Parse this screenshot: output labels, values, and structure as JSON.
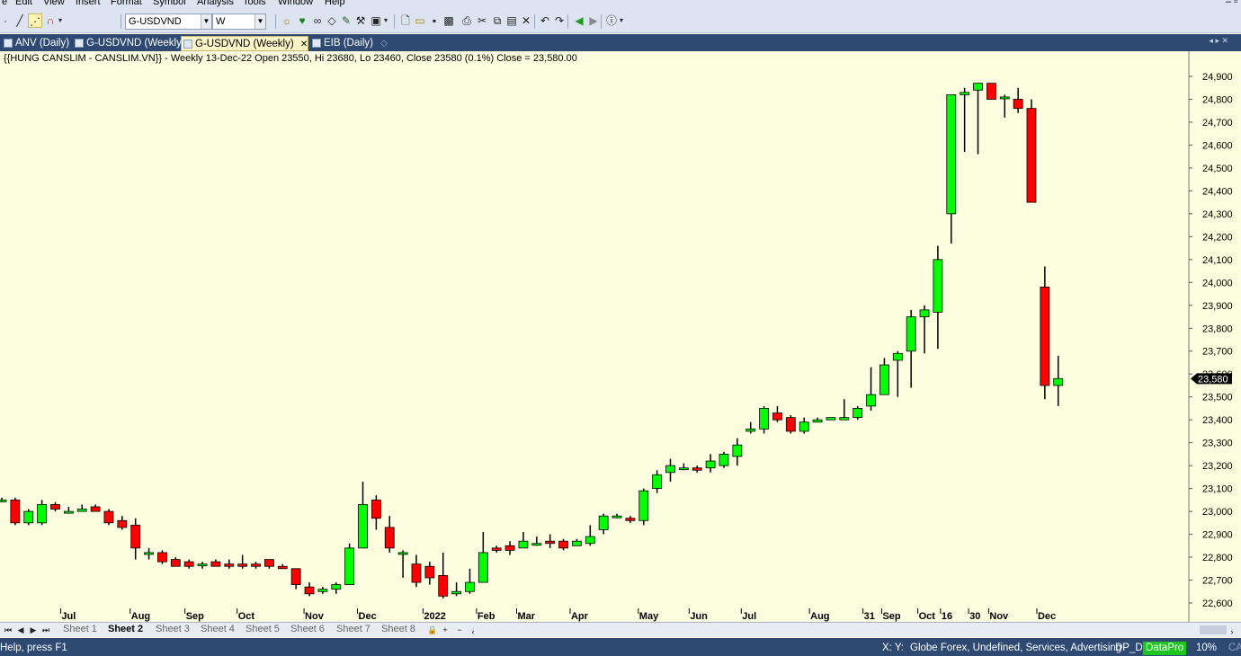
{
  "menu": [
    "e",
    "Edit",
    "View",
    "Insert",
    "Format",
    "Symbol",
    "Analysis",
    "Tools",
    "Window",
    "Help"
  ],
  "toolbar": {
    "symbol_value": "G-USDVND",
    "interval_value": "W"
  },
  "tabs": [
    {
      "label": "ANV (Daily)",
      "active": false
    },
    {
      "label": "G-USDVND (Weekly)",
      "active": false
    },
    {
      "label": "G-USDVND (Weekly)",
      "active": true
    },
    {
      "label": "EIB (Daily)",
      "active": false
    }
  ],
  "chart_title_line": "{{HUNG CANSLIM - CANSLIM.VN}} - Weekly 13-Dec-22 Open 23550, Hi 23680, Lo 23460, Close 23580 (0.1%) Close = 23,580.00",
  "sheets": {
    "nav": [
      "⏮",
      "◀",
      "▶",
      "⏭"
    ],
    "tabs": [
      "Sheet 1",
      "Sheet 2",
      "Sheet 3",
      "Sheet 4",
      "Sheet 5",
      "Sheet 6",
      "Sheet 7",
      "Sheet 8"
    ],
    "active": "Sheet 2"
  },
  "status": {
    "help": "Help, press F1",
    "xy": "X:  Y:",
    "info": "Globe Forex, Undefined, Services, Advertising",
    "db": "DP_D",
    "datapro": "DataPro",
    "pct": "10%",
    "cap": "CA"
  },
  "colors": {
    "up": "#00ff00",
    "down": "#ff0000",
    "background": "#fdfde0",
    "tabbar": "#2e4a73"
  },
  "chart_data": {
    "type": "candlestick",
    "symbol": "G-USDVND",
    "last_value_label": "23,580",
    "ylim": [
      22550,
      24980
    ],
    "y_ticks": [
      22600,
      22700,
      22800,
      22900,
      23000,
      23100,
      23200,
      23300,
      23400,
      23500,
      23600,
      23700,
      23800,
      23900,
      24000,
      24100,
      24200,
      24300,
      24400,
      24500,
      24600,
      24700,
      24800,
      24900
    ],
    "x_labels": [
      "Jul",
      "Aug",
      "Sep",
      "Oct",
      "Nov",
      "Dec",
      "2022",
      "Feb",
      "Mar",
      "Apr",
      "May",
      "Jun",
      "Jul",
      "Aug",
      "31",
      "Sep",
      "Oct",
      "16",
      "30",
      "Nov",
      "Dec"
    ],
    "candles": [
      {
        "o": 23050,
        "h": 23060,
        "l": 23040,
        "c": 23050
      },
      {
        "o": 23050,
        "h": 23060,
        "l": 22940,
        "c": 22950
      },
      {
        "o": 22950,
        "h": 23010,
        "l": 22940,
        "c": 23000
      },
      {
        "o": 22950,
        "h": 23050,
        "l": 22940,
        "c": 23030
      },
      {
        "o": 23030,
        "h": 23040,
        "l": 23000,
        "c": 23010
      },
      {
        "o": 23000,
        "h": 23020,
        "l": 22990,
        "c": 23000
      },
      {
        "o": 23000,
        "h": 23030,
        "l": 23000,
        "c": 23010
      },
      {
        "o": 23020,
        "h": 23030,
        "l": 23000,
        "c": 23000
      },
      {
        "o": 23000,
        "h": 23010,
        "l": 22940,
        "c": 22950
      },
      {
        "o": 22960,
        "h": 22980,
        "l": 22920,
        "c": 22930
      },
      {
        "o": 22940,
        "h": 22970,
        "l": 22790,
        "c": 22840
      },
      {
        "o": 22820,
        "h": 22840,
        "l": 22790,
        "c": 22820
      },
      {
        "o": 22820,
        "h": 22830,
        "l": 22770,
        "c": 22780
      },
      {
        "o": 22790,
        "h": 22800,
        "l": 22760,
        "c": 22760
      },
      {
        "o": 22780,
        "h": 22790,
        "l": 22750,
        "c": 22760
      },
      {
        "o": 22770,
        "h": 22780,
        "l": 22750,
        "c": 22770
      },
      {
        "o": 22780,
        "h": 22790,
        "l": 22760,
        "c": 22760
      },
      {
        "o": 22770,
        "h": 22790,
        "l": 22750,
        "c": 22760
      },
      {
        "o": 22770,
        "h": 22810,
        "l": 22750,
        "c": 22760
      },
      {
        "o": 22770,
        "h": 22780,
        "l": 22750,
        "c": 22760
      },
      {
        "o": 22790,
        "h": 22790,
        "l": 22750,
        "c": 22760
      },
      {
        "o": 22760,
        "h": 22770,
        "l": 22750,
        "c": 22750
      },
      {
        "o": 22750,
        "h": 22750,
        "l": 22660,
        "c": 22680
      },
      {
        "o": 22670,
        "h": 22690,
        "l": 22630,
        "c": 22640
      },
      {
        "o": 22650,
        "h": 22670,
        "l": 22640,
        "c": 22660
      },
      {
        "o": 22660,
        "h": 22690,
        "l": 22640,
        "c": 22680
      },
      {
        "o": 22680,
        "h": 22860,
        "l": 22680,
        "c": 22840
      },
      {
        "o": 22840,
        "h": 23130,
        "l": 22840,
        "c": 23030
      },
      {
        "o": 23050,
        "h": 23070,
        "l": 22920,
        "c": 22970
      },
      {
        "o": 22930,
        "h": 22980,
        "l": 22820,
        "c": 22840
      },
      {
        "o": 22820,
        "h": 22830,
        "l": 22710,
        "c": 22820
      },
      {
        "o": 22770,
        "h": 22810,
        "l": 22670,
        "c": 22690
      },
      {
        "o": 22760,
        "h": 22780,
        "l": 22680,
        "c": 22710
      },
      {
        "o": 22720,
        "h": 22820,
        "l": 22620,
        "c": 22630
      },
      {
        "o": 22640,
        "h": 22690,
        "l": 22630,
        "c": 22650
      },
      {
        "o": 22650,
        "h": 22750,
        "l": 22640,
        "c": 22690
      },
      {
        "o": 22690,
        "h": 22910,
        "l": 22690,
        "c": 22820
      },
      {
        "o": 22840,
        "h": 22850,
        "l": 22820,
        "c": 22830
      },
      {
        "o": 22850,
        "h": 22870,
        "l": 22810,
        "c": 22830
      },
      {
        "o": 22840,
        "h": 22910,
        "l": 22840,
        "c": 22870
      },
      {
        "o": 22860,
        "h": 22890,
        "l": 22850,
        "c": 22860
      },
      {
        "o": 22870,
        "h": 22900,
        "l": 22840,
        "c": 22860
      },
      {
        "o": 22870,
        "h": 22880,
        "l": 22830,
        "c": 22840
      },
      {
        "o": 22850,
        "h": 22880,
        "l": 22850,
        "c": 22870
      },
      {
        "o": 22860,
        "h": 22940,
        "l": 22850,
        "c": 22890
      },
      {
        "o": 22920,
        "h": 22990,
        "l": 22900,
        "c": 22980
      },
      {
        "o": 22980,
        "h": 22990,
        "l": 22970,
        "c": 22980
      },
      {
        "o": 22970,
        "h": 22980,
        "l": 22950,
        "c": 22960
      },
      {
        "o": 22960,
        "h": 23100,
        "l": 22940,
        "c": 23090
      },
      {
        "o": 23100,
        "h": 23180,
        "l": 23080,
        "c": 23160
      },
      {
        "o": 23170,
        "h": 23230,
        "l": 23130,
        "c": 23200
      },
      {
        "o": 23190,
        "h": 23210,
        "l": 23180,
        "c": 23190
      },
      {
        "o": 23190,
        "h": 23200,
        "l": 23170,
        "c": 23180
      },
      {
        "o": 23190,
        "h": 23250,
        "l": 23170,
        "c": 23220
      },
      {
        "o": 23200,
        "h": 23260,
        "l": 23190,
        "c": 23250
      },
      {
        "o": 23240,
        "h": 23320,
        "l": 23200,
        "c": 23290
      },
      {
        "o": 23350,
        "h": 23390,
        "l": 23340,
        "c": 23360
      },
      {
        "o": 23360,
        "h": 23460,
        "l": 23340,
        "c": 23450
      },
      {
        "o": 23430,
        "h": 23460,
        "l": 23390,
        "c": 23400
      },
      {
        "o": 23410,
        "h": 23420,
        "l": 23340,
        "c": 23350
      },
      {
        "o": 23350,
        "h": 23410,
        "l": 23340,
        "c": 23390
      },
      {
        "o": 23390,
        "h": 23410,
        "l": 23390,
        "c": 23400
      },
      {
        "o": 23400,
        "h": 23410,
        "l": 23400,
        "c": 23410
      },
      {
        "o": 23400,
        "h": 23490,
        "l": 23400,
        "c": 23410
      },
      {
        "o": 23410,
        "h": 23460,
        "l": 23400,
        "c": 23450
      },
      {
        "o": 23460,
        "h": 23630,
        "l": 23440,
        "c": 23510
      },
      {
        "o": 23510,
        "h": 23670,
        "l": 23510,
        "c": 23640
      },
      {
        "o": 23660,
        "h": 23700,
        "l": 23500,
        "c": 23690
      },
      {
        "o": 23700,
        "h": 23880,
        "l": 23540,
        "c": 23850
      },
      {
        "o": 23850,
        "h": 23900,
        "l": 23690,
        "c": 23880
      },
      {
        "o": 23870,
        "h": 24160,
        "l": 23710,
        "c": 24100
      },
      {
        "o": 24300,
        "h": 24820,
        "l": 24170,
        "c": 24820
      },
      {
        "o": 24820,
        "h": 24850,
        "l": 24570,
        "c": 24830
      },
      {
        "o": 24840,
        "h": 24870,
        "l": 24560,
        "c": 24870
      },
      {
        "o": 24870,
        "h": 24870,
        "l": 24800,
        "c": 24800
      },
      {
        "o": 24810,
        "h": 24820,
        "l": 24720,
        "c": 24810
      },
      {
        "o": 24800,
        "h": 24850,
        "l": 24740,
        "c": 24760
      },
      {
        "o": 24760,
        "h": 24800,
        "l": 24350,
        "c": 24350
      },
      {
        "o": 23980,
        "h": 24070,
        "l": 23490,
        "c": 23550
      },
      {
        "o": 23550,
        "h": 23680,
        "l": 23460,
        "c": 23580
      }
    ]
  }
}
